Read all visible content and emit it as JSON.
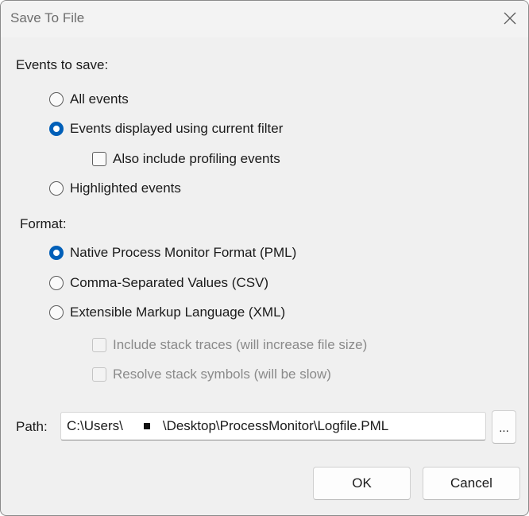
{
  "window": {
    "title": "Save To File"
  },
  "events_section": {
    "label": "Events to save:",
    "options": [
      {
        "label": "All events",
        "checked": false
      },
      {
        "label": "Events displayed using current filter",
        "checked": true
      },
      {
        "label": "Highlighted events",
        "checked": false
      }
    ],
    "profiling_checkbox": {
      "label": "Also include profiling events",
      "checked": false
    }
  },
  "format_section": {
    "label": "Format:",
    "options": [
      {
        "label": "Native Process Monitor Format (PML)",
        "checked": true
      },
      {
        "label": "Comma-Separated Values (CSV)",
        "checked": false
      },
      {
        "label": "Extensible Markup Language (XML)",
        "checked": false
      }
    ],
    "xml_options": [
      {
        "label": "Include stack traces (will increase file size)",
        "checked": false,
        "disabled": true
      },
      {
        "label": "Resolve stack symbols (will be slow)",
        "checked": false,
        "disabled": true
      }
    ]
  },
  "path": {
    "label": "Path:",
    "value_prefix": "C:\\Users\\",
    "value_suffix": "\\Desktop\\ProcessMonitor\\Logfile.PML",
    "browse_label": "..."
  },
  "buttons": {
    "ok": "OK",
    "cancel": "Cancel"
  },
  "colors": {
    "accent": "#005fb8",
    "dialog_bg": "#f0f0f0",
    "disabled_text": "#8a8a8a"
  }
}
